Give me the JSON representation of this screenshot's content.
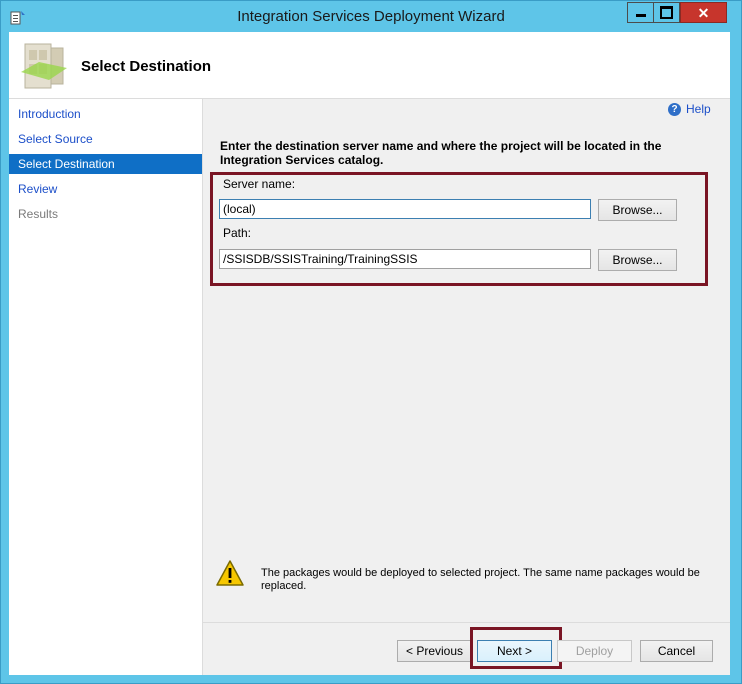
{
  "window": {
    "title": "Integration Services Deployment Wizard",
    "controls": {
      "minimize": "minimize",
      "maximize": "maximize",
      "close": "✕"
    }
  },
  "header": {
    "title": "Select Destination"
  },
  "sidebar": {
    "items": [
      {
        "label": "Introduction",
        "state": "link"
      },
      {
        "label": "Select Source",
        "state": "link"
      },
      {
        "label": "Select Destination",
        "state": "active"
      },
      {
        "label": "Review",
        "state": "link"
      },
      {
        "label": "Results",
        "state": "disabled"
      }
    ]
  },
  "help": {
    "label": "Help",
    "icon": "?"
  },
  "main": {
    "instruction": "Enter the destination server name and where the project will be located in the Integration Services catalog.",
    "server_name": {
      "label": "Server name:",
      "value": "(local)",
      "browse_label": "Browse..."
    },
    "path": {
      "label": "Path:",
      "value": "/SSISDB/SSISTraining/TrainingSSIS",
      "browse_label": "Browse..."
    }
  },
  "warning": {
    "icon": "warning-icon",
    "text": "The packages would be deployed to selected project. The same name packages would be replaced."
  },
  "footer": {
    "previous_label": "< Previous",
    "next_label": "Next >",
    "deploy_label": "Deploy",
    "cancel_label": "Cancel"
  },
  "colors": {
    "titlebar": "#5ec5e8",
    "active_nav": "#0f6fc6",
    "link": "#1c4fc9",
    "highlight_border": "#7a1524",
    "close_button": "#c7352c"
  }
}
